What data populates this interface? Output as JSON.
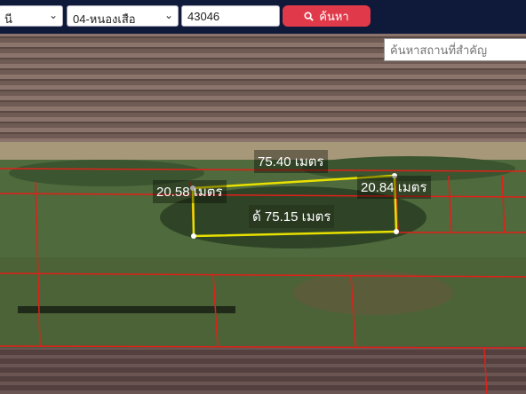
{
  "toolbar": {
    "province_value": "นี",
    "district_value": "04-หนองเสือ",
    "parcel_number": "43046",
    "search_label": "ค้นหา"
  },
  "place_search": {
    "placeholder": "ค้นหาสถานที่สำคัญ"
  },
  "measurements": {
    "top_edge": "75.40 เมตร",
    "left_edge": "20.58 เมตร",
    "right_edge": "20.84 เมตร",
    "bottom_edge": "ด้ 75.15 เมตร"
  },
  "colors": {
    "header_bg": "#0f1a3a",
    "search_button": "#e03a4a",
    "parcel_outline": "#e8e000",
    "neighbor_outline": "#e0201a"
  },
  "icons": {
    "search_button_icon": "search-icon",
    "dropdown_icon": "chevron-down-icon"
  }
}
